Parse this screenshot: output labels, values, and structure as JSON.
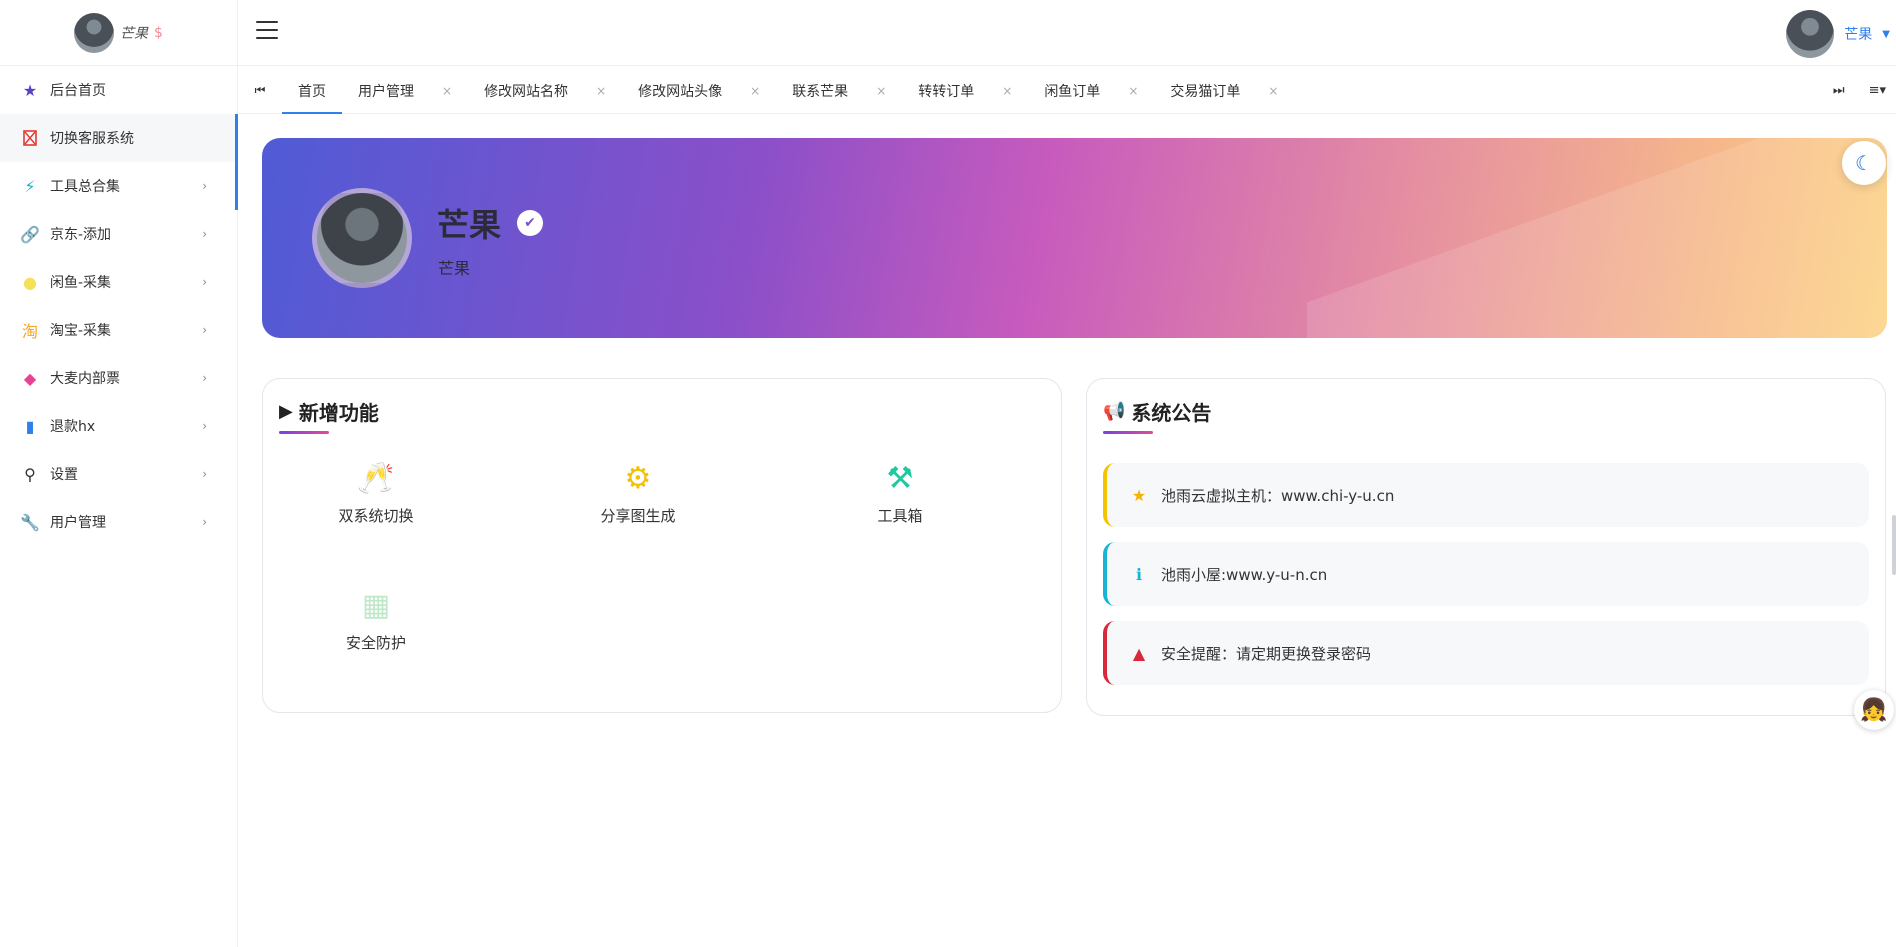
{
  "brand": {
    "name": "芒果",
    "coin_icon": "dollar-icon"
  },
  "sidebar": {
    "items": [
      {
        "label": "后台首页",
        "icon": "star-icon",
        "color": "#5a3fc8",
        "has_children": false
      },
      {
        "label": "切换客服系统",
        "icon": "broken-image-icon",
        "color": "#e53935",
        "has_children": false
      },
      {
        "label": "工具总合集",
        "icon": "lightning-icon",
        "color": "#18b4c9",
        "has_children": true
      },
      {
        "label": "京东-添加",
        "icon": "link-icon",
        "color": "#333333",
        "has_children": true
      },
      {
        "label": "闲鱼-采集",
        "icon": "fish-icon",
        "color": "#f5e05a",
        "has_children": true
      },
      {
        "label": "淘宝-采集",
        "icon": "taobao-icon",
        "color": "#f5a623",
        "has_children": true
      },
      {
        "label": "大麦内部票",
        "icon": "diamond-icon",
        "color": "#e84393",
        "has_children": true
      },
      {
        "label": "退款hx",
        "icon": "phone-icon",
        "color": "#2f80ed",
        "has_children": true
      },
      {
        "label": "设置",
        "icon": "footprint-icon",
        "color": "#333333",
        "has_children": true
      },
      {
        "label": "用户管理",
        "icon": "wrench-icon",
        "color": "#555555",
        "has_children": true
      }
    ],
    "active_index": 1
  },
  "topbar": {
    "user_name": "芒果"
  },
  "tabs": [
    {
      "label": "首页",
      "closable": false,
      "active": true
    },
    {
      "label": "用户管理",
      "closable": true
    },
    {
      "label": "修改网站名称",
      "closable": true
    },
    {
      "label": "修改网站头像",
      "closable": true
    },
    {
      "label": "联系芒果",
      "closable": true
    },
    {
      "label": "转转订单",
      "closable": true
    },
    {
      "label": "闲鱼订单",
      "closable": true
    },
    {
      "label": "交易猫订单",
      "closable": true
    }
  ],
  "tab_close_glyph": "×",
  "hero": {
    "title": "芒果",
    "subtitle": "芒果"
  },
  "features": {
    "title": "新增功能",
    "items": [
      {
        "label": "双系统切换",
        "icon": "cheers-icon",
        "color": "#f6a6b8"
      },
      {
        "label": "分享图生成",
        "icon": "gears-icon",
        "color": "#f2c200"
      },
      {
        "label": "工具箱",
        "icon": "compass-icon",
        "color": "#1fc9a0"
      },
      {
        "label": "安全防护",
        "icon": "shield-icon",
        "color": "#bfe8c8"
      }
    ]
  },
  "announcements": {
    "title": "系统公告",
    "items": [
      {
        "text": "池雨云虚拟主机：www.chi-y-u.cn",
        "icon": "star-icon",
        "level": "yellow"
      },
      {
        "text": "池雨小屋:www.y-u-n.cn",
        "icon": "info-icon",
        "level": "cyan"
      },
      {
        "text": "安全提醒：请定期更换登录密码",
        "icon": "warning-icon",
        "level": "red"
      }
    ]
  },
  "colors": {
    "accent": "#2f80ed",
    "hero_start": "#4f5bd5",
    "hero_mid": "#c85bbd",
    "hero_end": "#fcd284"
  }
}
